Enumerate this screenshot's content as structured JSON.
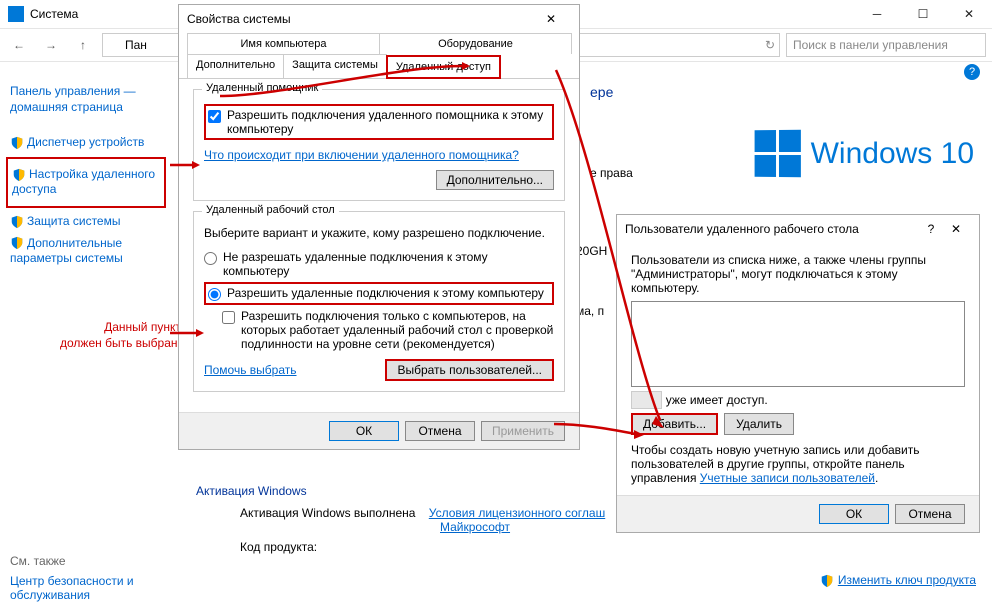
{
  "explorer": {
    "title": "Система",
    "breadcrumb": "Пан",
    "search_placeholder": "Поиск в панели управления"
  },
  "leftnav": {
    "home": "Панель управления — домашняя страница",
    "items": [
      "Диспетчер устройств",
      "Настройка удаленного доступа",
      "Защита системы",
      "Дополнительные параметры системы"
    ],
    "seealso_title": "См. также",
    "seealso": "Центр безопасности и обслуживания"
  },
  "main": {
    "heading_partial": "ере",
    "rights_label": "е права",
    "cpu_fragment": "20GH",
    "ram_label": "ма, п",
    "activation_heading": "Активация Windows",
    "activation_status": "Активация Windows выполнена",
    "license_link": "Условия лицензионного соглаш",
    "ms": "Майкрософт",
    "product_code_label": "Код продукта:",
    "change_key": "Изменить ключ продукта",
    "winlogo_text": "Windows 10"
  },
  "annot": {
    "line1": "Данный пункт",
    "line2": "должен быть выбран!"
  },
  "dlg1": {
    "title": "Свойства системы",
    "tabs_row1": [
      "Имя компьютера",
      "Оборудование"
    ],
    "tabs_row2": [
      "Дополнительно",
      "Защита системы",
      "Удаленный доступ"
    ],
    "group1_legend": "Удаленный помощник",
    "chk1": "Разрешить подключения удаленного помощника к этому компьютеру",
    "link1": "Что происходит при включении удаленного помощника?",
    "btn_adv": "Дополнительно...",
    "group2_legend": "Удаленный рабочий стол",
    "desc2": "Выберите вариант и укажите, кому разрешено подключение.",
    "radio1": "Не разрешать удаленные подключения к этому компьютеру",
    "radio2": "Разрешить удаленные подключения к этому компьютеру",
    "chk2": "Разрешить подключения только с компьютеров, на которых работает удаленный рабочий стол с проверкой подлинности на уровне сети (рекомендуется)",
    "link2": "Помочь выбрать",
    "btn_users": "Выбрать пользователей...",
    "ok": "ОК",
    "cancel": "Отмена",
    "apply": "Применить"
  },
  "dlg2": {
    "title": "Пользователи удаленного рабочего стола",
    "desc": "Пользователи из списка ниже, а также члены группы \"Администраторы\", могут подключаться к этому компьютеру.",
    "access_note": "уже имеет доступ.",
    "add": "Добавить...",
    "remove": "Удалить",
    "footer_text": "Чтобы создать новую учетную запись или добавить пользователей в другие группы, откройте панель управления ",
    "footer_link": "Учетные записи пользователей",
    "ok": "ОК",
    "cancel": "Отмена"
  }
}
